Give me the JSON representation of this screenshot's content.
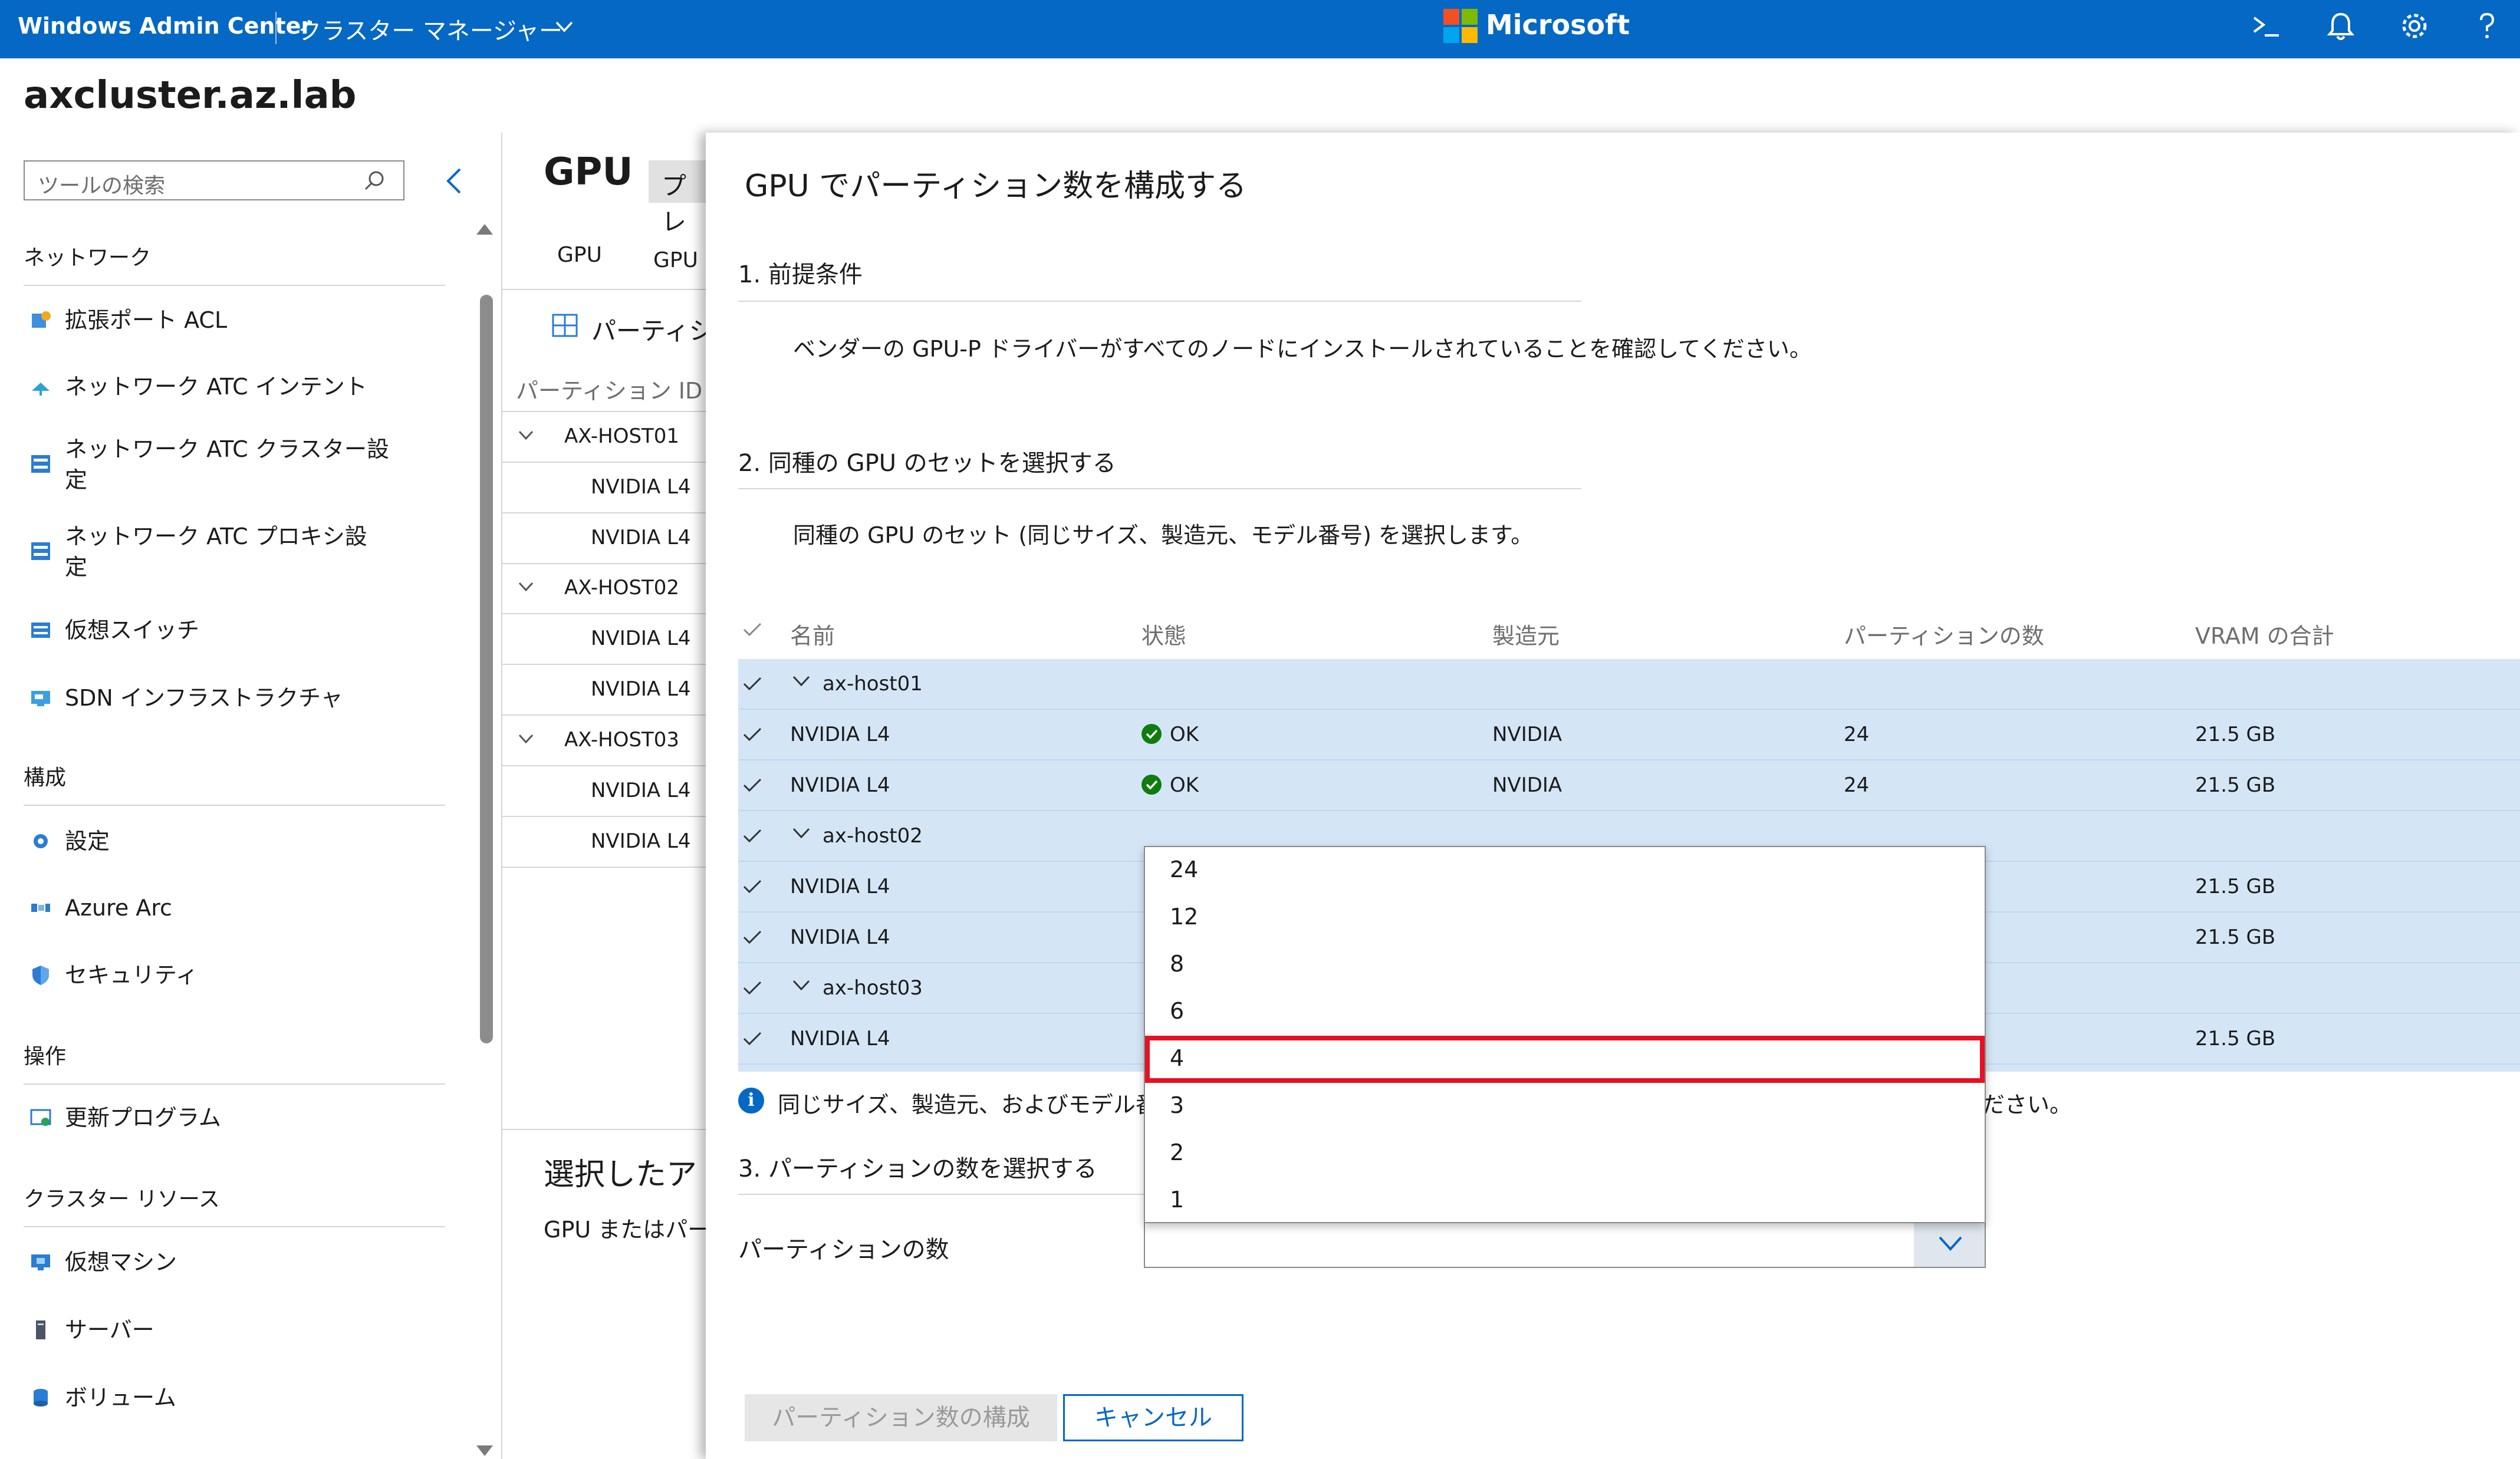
{
  "header": {
    "product": "Windows Admin Center",
    "app_name": "クラスター マネージャー",
    "brand": "Microsoft",
    "icons": [
      "terminal-icon",
      "bell-icon",
      "gear-icon",
      "help-icon"
    ]
  },
  "page_title": "axcluster.az.lab",
  "sidebar": {
    "search_placeholder": "ツールの検索",
    "sections": [
      {
        "title": "ネットワーク",
        "items": [
          {
            "label": "拡張ポート ACL",
            "icon": "acl-icon"
          },
          {
            "label": "ネットワーク ATC インテント",
            "icon": "network-icon"
          },
          {
            "label": "ネットワーク ATC クラスター設\n定",
            "icon": "server-icon"
          },
          {
            "label": "ネットワーク ATC プロキシ設\n定",
            "icon": "server-icon"
          },
          {
            "label": "仮想スイッチ",
            "icon": "switch-icon"
          },
          {
            "label": "SDN インフラストラクチャ",
            "icon": "sdn-icon"
          }
        ]
      },
      {
        "title": "構成",
        "items": [
          {
            "label": "設定",
            "icon": "gear-icon"
          },
          {
            "label": "Azure Arc",
            "icon": "arc-icon"
          },
          {
            "label": "セキュリティ",
            "icon": "shield-icon"
          }
        ]
      },
      {
        "title": "操作",
        "items": [
          {
            "label": "更新プログラム",
            "icon": "update-icon"
          }
        ]
      },
      {
        "title": "クラスター リソース",
        "items": [
          {
            "label": "仮想マシン",
            "icon": "vm-icon"
          },
          {
            "label": "サーバー",
            "icon": "server-icon"
          },
          {
            "label": "ボリューム",
            "icon": "volume-icon"
          }
        ]
      }
    ]
  },
  "middle": {
    "title": "GPU",
    "badge": "プレ",
    "tabs": [
      "GPU",
      "GPU プ"
    ],
    "command": "パーティシ",
    "column": "パーティション ID",
    "rows": [
      {
        "label": "AX-HOST01",
        "group": true
      },
      {
        "label": "NVIDIA L4",
        "group": false
      },
      {
        "label": "NVIDIA L4",
        "group": false
      },
      {
        "label": "AX-HOST02",
        "group": true
      },
      {
        "label": "NVIDIA L4",
        "group": false
      },
      {
        "label": "NVIDIA L4",
        "group": false
      },
      {
        "label": "AX-HOST03",
        "group": true
      },
      {
        "label": "NVIDIA L4",
        "group": false
      },
      {
        "label": "NVIDIA L4",
        "group": false
      }
    ],
    "lower_title": "選択したア",
    "lower_text": "GPU またはパー"
  },
  "panel": {
    "title": "GPU でパーティション数を構成する",
    "section1": {
      "title": "1. 前提条件",
      "text": "ベンダーの GPU-P ドライバーがすべてのノードにインストールされていることを確認してください。"
    },
    "section2": {
      "title": "2. 同種の GPU のセットを選択する",
      "text": "同種の GPU のセット (同じサイズ、製造元、モデル番号) を選択します。"
    },
    "table": {
      "columns": [
        "名前",
        "状態",
        "製造元",
        "パーティションの数",
        "VRAM の合計"
      ],
      "rows": [
        {
          "group": true,
          "name": "ax-host01"
        },
        {
          "group": false,
          "name": "NVIDIA L4",
          "status": "OK",
          "maker": "NVIDIA",
          "partitions": "24",
          "vram": "21.5 GB"
        },
        {
          "group": false,
          "name": "NVIDIA L4",
          "status": "OK",
          "maker": "NVIDIA",
          "partitions": "24",
          "vram": "21.5 GB"
        },
        {
          "group": true,
          "name": "ax-host02"
        },
        {
          "group": false,
          "name": "NVIDIA L4",
          "status": "",
          "maker": "",
          "partitions": "",
          "vram": "21.5 GB"
        },
        {
          "group": false,
          "name": "NVIDIA L4",
          "status": "",
          "maker": "",
          "partitions": "",
          "vram": "21.5 GB"
        },
        {
          "group": true,
          "name": "ax-host03"
        },
        {
          "group": false,
          "name": "NVIDIA L4",
          "status": "",
          "maker": "",
          "partitions": "",
          "vram": "21.5 GB"
        }
      ]
    },
    "info_text": "同じサイズ、製造元、およびモデル番",
    "info_tail": "ください。",
    "section3": {
      "title": "3. パーティションの数を選択する",
      "field_label": "パーティションの数"
    },
    "dropdown": {
      "options": [
        "24",
        "12",
        "8",
        "6",
        "4",
        "3",
        "2",
        "1"
      ],
      "highlighted": "4"
    },
    "buttons": {
      "configure": "パーティション数の構成",
      "cancel": "キャンセル"
    }
  },
  "colors": {
    "accent": "#0468c4",
    "selected_row": "#d4e6f6",
    "ok": "#107c10",
    "highlight_border": "#e81123"
  }
}
